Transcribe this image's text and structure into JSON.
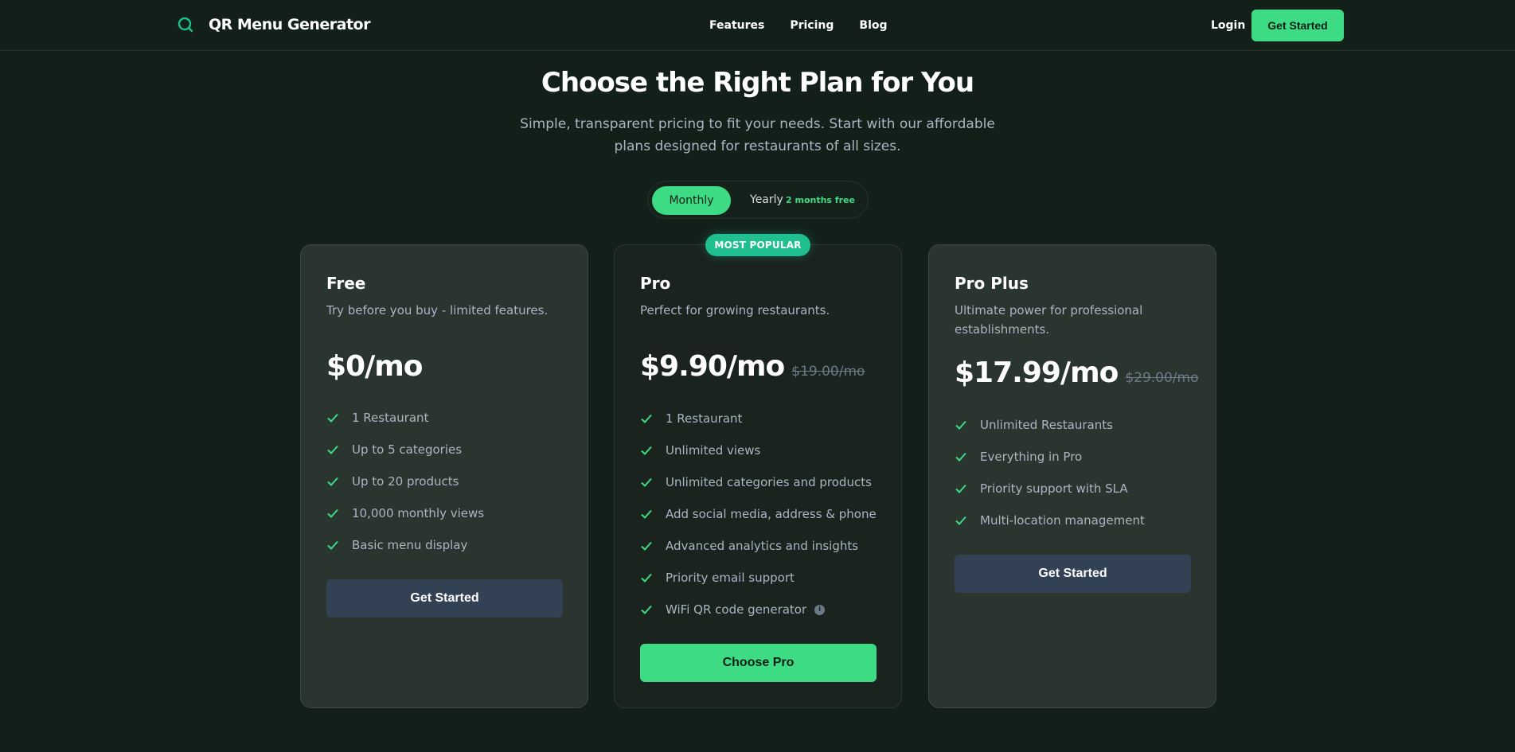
{
  "header": {
    "brand": "QR Menu Generator",
    "nav": [
      "Features",
      "Pricing",
      "Blog"
    ],
    "login": "Login",
    "cta": "Get Started",
    "logo_icon": "search-icon"
  },
  "hero": {
    "title": "Choose the Right Plan for You",
    "subtitle": "Simple, transparent pricing to fit your needs. Start with our affordable plans designed for restaurants of all sizes."
  },
  "billing_toggle": {
    "monthly": "Monthly",
    "yearly": "Yearly",
    "yearly_badge": "2 months free",
    "selected": "Monthly"
  },
  "colors": {
    "accent": "#3ddc84",
    "badge": "#1fbf8f",
    "background": "#13201a"
  },
  "plans": [
    {
      "name": "Free",
      "description": "Try before you buy - limited features.",
      "price": "$0/mo",
      "old_price": "",
      "features": [
        "1 Restaurant",
        "Up to 5 categories",
        "Up to 20 products",
        "10,000 monthly views",
        "Basic menu display"
      ],
      "button": "Get Started"
    },
    {
      "name": "Pro",
      "badge": "MOST POPULAR",
      "description": "Perfect for growing restaurants.",
      "price": "$9.90/mo",
      "old_price": "$19.00/mo",
      "features": [
        "1 Restaurant",
        "Unlimited views",
        "Unlimited categories and products",
        "Add social media, address & phone",
        "Advanced analytics and insights",
        "Priority email support",
        "WiFi QR code generator"
      ],
      "info_icon": "info-icon",
      "button": "Choose Pro"
    },
    {
      "name": "Pro Plus",
      "description": "Ultimate power for professional establishments.",
      "price": "$17.99/mo",
      "old_price": "$29.00/mo",
      "features": [
        "Unlimited Restaurants",
        "Everything in Pro",
        "Priority support with SLA",
        "Multi-location management"
      ],
      "button": "Get Started"
    }
  ]
}
